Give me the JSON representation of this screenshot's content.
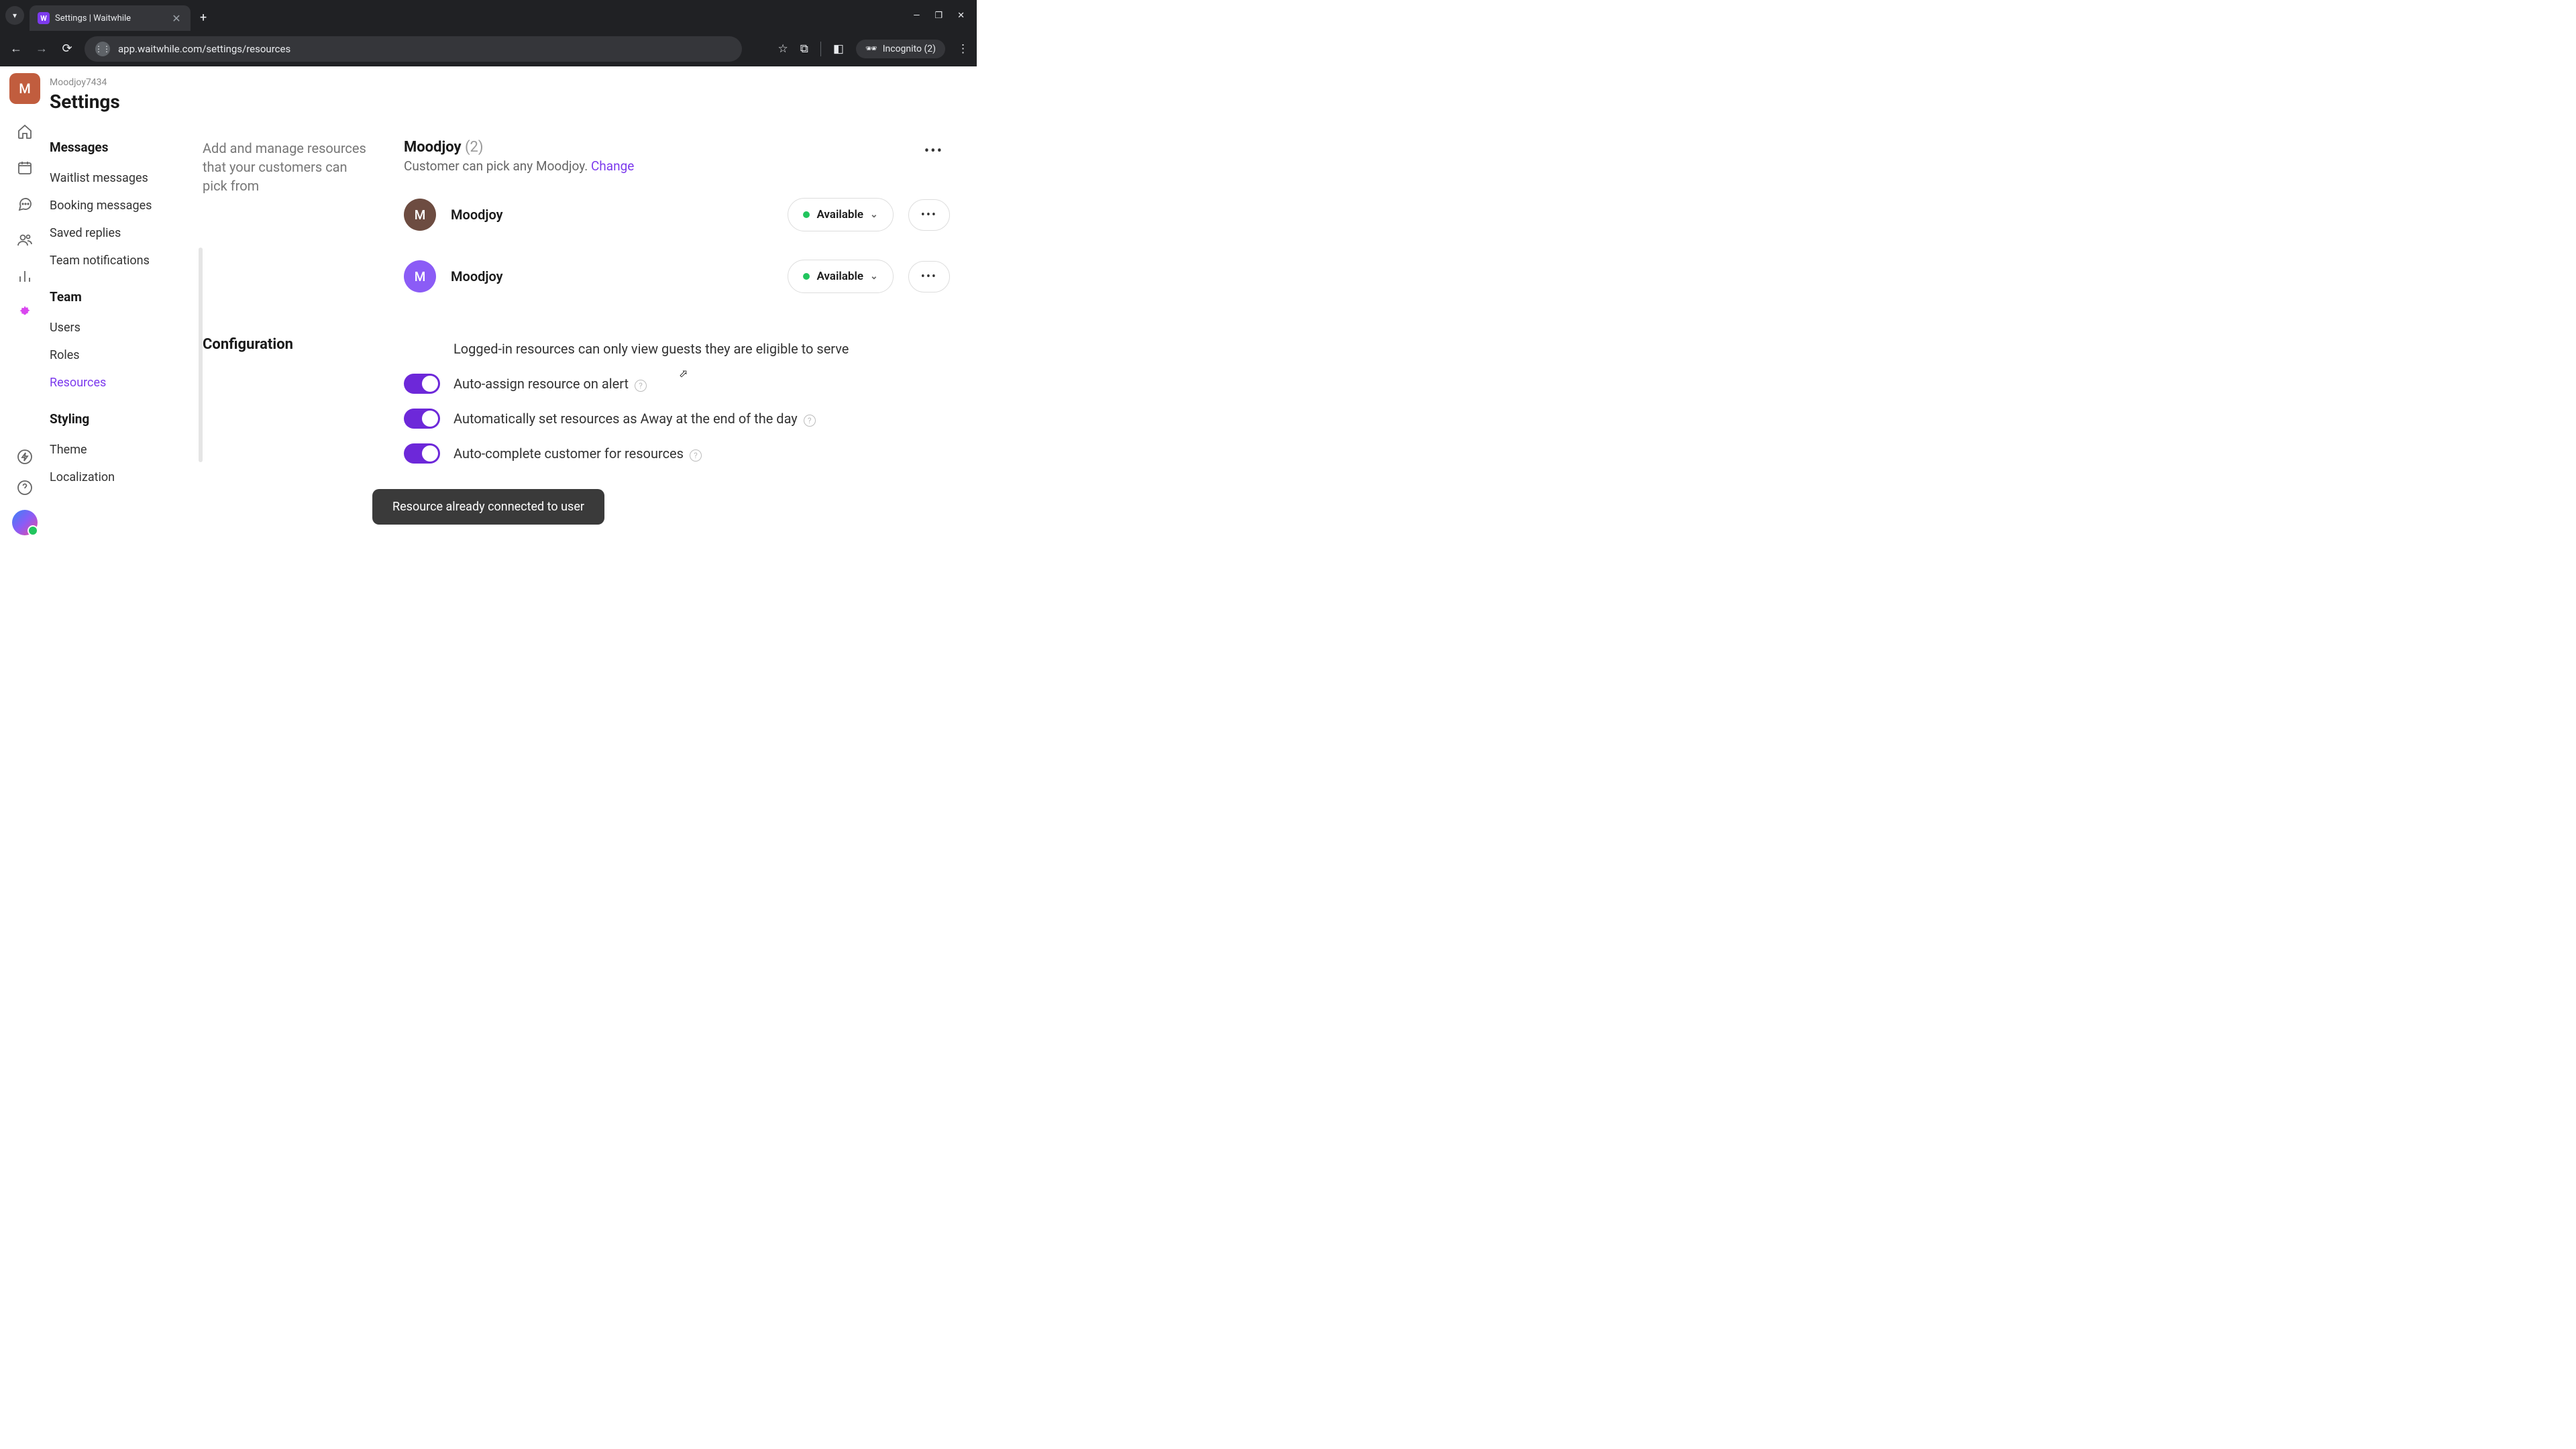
{
  "browser": {
    "tab_title": "Settings | Waitwhile",
    "url": "app.waitwhile.com/settings/resources",
    "incognito_label": "Incognito (2)"
  },
  "header": {
    "org": "Moodjoy7434",
    "title": "Settings",
    "avatar_initial": "M"
  },
  "sidebar": {
    "sections": [
      {
        "title": "Messages",
        "items": [
          "Waitlist messages",
          "Booking messages",
          "Saved replies",
          "Team notifications"
        ]
      },
      {
        "title": "Team",
        "items": [
          "Users",
          "Roles",
          "Resources"
        ]
      },
      {
        "title": "Styling",
        "items": [
          "Theme",
          "Localization"
        ]
      }
    ],
    "active_item": "Resources"
  },
  "main": {
    "description": "Add and manage resources that your customers can pick from",
    "config_heading": "Configuration",
    "resource_group": {
      "name": "Moodjoy",
      "count": "(2)",
      "subtitle_prefix": "Customer can pick any Moodjoy. ",
      "change_label": "Change"
    },
    "resources": [
      {
        "initial": "M",
        "name": "Moodjoy",
        "status": "Available",
        "avatar_color": "brown"
      },
      {
        "initial": "M",
        "name": "Moodjoy",
        "status": "Available",
        "avatar_color": "purple"
      }
    ],
    "config": [
      {
        "label": "Logged-in resources can only view guests they are eligible to serve",
        "toggle": null,
        "help": false
      },
      {
        "label": "Auto-assign resource on alert",
        "toggle": true,
        "help": true
      },
      {
        "label": "Automatically set resources as Away at the end of the day",
        "toggle": true,
        "help": true
      },
      {
        "label": "Auto-complete customer for resources",
        "toggle": true,
        "help": true
      }
    ]
  },
  "toast": "Resource already connected to user"
}
